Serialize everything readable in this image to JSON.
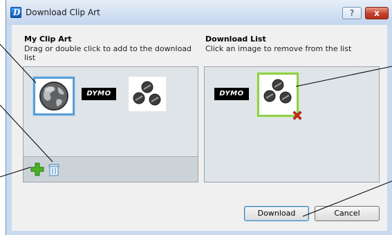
{
  "window": {
    "title": "Download Clip Art",
    "icon": "dymo-app-icon",
    "help_label": "?",
    "close_label": "x"
  },
  "my_clip_art": {
    "heading": "My Clip Art",
    "instructions": "Drag or double click to add to the download list",
    "items": [
      {
        "name": "globe",
        "selected": true
      },
      {
        "name": "dymo-logo",
        "text": "DYMO"
      },
      {
        "name": "screws"
      }
    ],
    "toolbar": {
      "add_icon": "add-plus-icon",
      "delete_icon": "trash-icon"
    }
  },
  "download_list": {
    "heading": "Download List",
    "instructions": "Click an image to remove from the list",
    "items": [
      {
        "name": "dymo-logo",
        "text": "DYMO"
      },
      {
        "name": "screws",
        "highlighted": true,
        "remove_icon": "red-x-icon"
      }
    ]
  },
  "buttons": {
    "download": "Download",
    "cancel": "Cancel"
  },
  "colors": {
    "selection_blue": "#5a9ed6",
    "highlight_green": "#8fcf4a",
    "remove_red": "#d8291b",
    "add_green": "#4caf26"
  }
}
